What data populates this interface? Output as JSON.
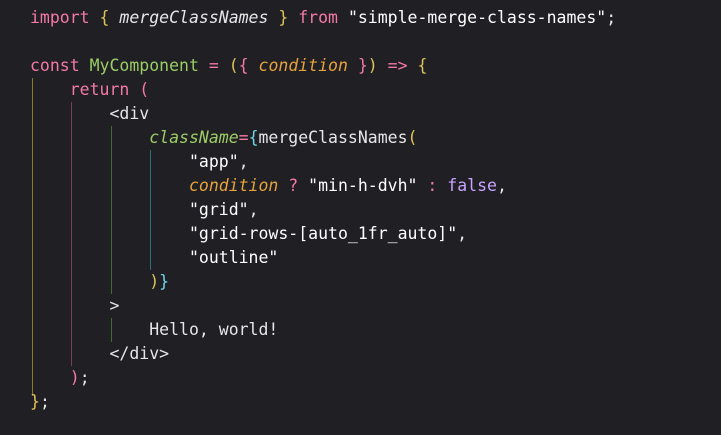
{
  "colors": {
    "background": "#1f1f24",
    "keyword": "#f47aa3",
    "punct": "#e0c357",
    "ident": "#e6e6e6",
    "param": "#e6a23c",
    "string": "#ffffff",
    "component": "#9ccc65",
    "attr": "#6fd6ea",
    "bool": "#c9a3ff",
    "tag": "#e6e6e6",
    "guide_yellow": "#8a7a2c",
    "guide_pink": "#7a3e56",
    "guide_green": "#3e6e2e",
    "guide_cyan": "#2e6e7a"
  },
  "lines": [
    [
      {
        "t": "import",
        "c": "keyword"
      },
      {
        "t": " ",
        "c": "ident"
      },
      {
        "t": "{",
        "c": "punct"
      },
      {
        "t": " ",
        "c": "ident"
      },
      {
        "t": "mergeClassNames",
        "c": "ident",
        "i": true
      },
      {
        "t": " ",
        "c": "ident"
      },
      {
        "t": "}",
        "c": "punct"
      },
      {
        "t": " ",
        "c": "ident"
      },
      {
        "t": "from",
        "c": "keyword"
      },
      {
        "t": " ",
        "c": "ident"
      },
      {
        "t": "\"simple-merge-class-names\"",
        "c": "string"
      },
      {
        "t": ";",
        "c": "ident"
      }
    ],
    [],
    [
      {
        "t": "const",
        "c": "keyword"
      },
      {
        "t": " ",
        "c": "ident"
      },
      {
        "t": "MyComponent",
        "c": "component"
      },
      {
        "t": " ",
        "c": "ident"
      },
      {
        "t": "=",
        "c": "keyword"
      },
      {
        "t": " ",
        "c": "ident"
      },
      {
        "t": "(",
        "c": "punct"
      },
      {
        "t": "{",
        "c": "keyword"
      },
      {
        "t": " ",
        "c": "ident"
      },
      {
        "t": "condition",
        "c": "param",
        "i": true
      },
      {
        "t": " ",
        "c": "ident"
      },
      {
        "t": "}",
        "c": "keyword"
      },
      {
        "t": ")",
        "c": "punct"
      },
      {
        "t": " ",
        "c": "ident"
      },
      {
        "t": "=>",
        "c": "keyword"
      },
      {
        "t": " ",
        "c": "ident"
      },
      {
        "t": "{",
        "c": "punct"
      }
    ],
    [
      {
        "t": "    ",
        "c": "ident"
      },
      {
        "t": "return",
        "c": "keyword"
      },
      {
        "t": " ",
        "c": "ident"
      },
      {
        "t": "(",
        "c": "keyword"
      }
    ],
    [
      {
        "t": "        ",
        "c": "ident"
      },
      {
        "t": "<div",
        "c": "tag"
      }
    ],
    [
      {
        "t": "            ",
        "c": "ident"
      },
      {
        "t": "className",
        "c": "component",
        "i": true
      },
      {
        "t": "=",
        "c": "keyword"
      },
      {
        "t": "{",
        "c": "attr"
      },
      {
        "t": "mergeClassNames",
        "c": "ident"
      },
      {
        "t": "(",
        "c": "punct"
      }
    ],
    [
      {
        "t": "                ",
        "c": "ident"
      },
      {
        "t": "\"app\"",
        "c": "string"
      },
      {
        "t": ",",
        "c": "ident"
      }
    ],
    [
      {
        "t": "                ",
        "c": "ident"
      },
      {
        "t": "condition",
        "c": "param",
        "i": true
      },
      {
        "t": " ",
        "c": "ident"
      },
      {
        "t": "?",
        "c": "keyword"
      },
      {
        "t": " ",
        "c": "ident"
      },
      {
        "t": "\"min-h-dvh\"",
        "c": "string"
      },
      {
        "t": " ",
        "c": "ident"
      },
      {
        "t": ":",
        "c": "keyword"
      },
      {
        "t": " ",
        "c": "ident"
      },
      {
        "t": "false",
        "c": "bool"
      },
      {
        "t": ",",
        "c": "ident"
      }
    ],
    [
      {
        "t": "                ",
        "c": "ident"
      },
      {
        "t": "\"grid\"",
        "c": "string"
      },
      {
        "t": ",",
        "c": "ident"
      }
    ],
    [
      {
        "t": "                ",
        "c": "ident"
      },
      {
        "t": "\"grid-rows-[auto_1fr_auto]\"",
        "c": "string"
      },
      {
        "t": ",",
        "c": "ident"
      }
    ],
    [
      {
        "t": "                ",
        "c": "ident"
      },
      {
        "t": "\"outline\"",
        "c": "string"
      }
    ],
    [
      {
        "t": "            ",
        "c": "ident"
      },
      {
        "t": ")",
        "c": "punct"
      },
      {
        "t": "}",
        "c": "attr"
      }
    ],
    [
      {
        "t": "        ",
        "c": "ident"
      },
      {
        "t": ">",
        "c": "tag"
      }
    ],
    [
      {
        "t": "            ",
        "c": "ident"
      },
      {
        "t": "Hello, world!",
        "c": "ident"
      }
    ],
    [
      {
        "t": "        ",
        "c": "ident"
      },
      {
        "t": "</div>",
        "c": "tag"
      }
    ],
    [
      {
        "t": "    ",
        "c": "ident"
      },
      {
        "t": ")",
        "c": "keyword"
      },
      {
        "t": ";",
        "c": "ident"
      }
    ],
    [
      {
        "t": "}",
        "c": "punct"
      },
      {
        "t": ";",
        "c": "ident"
      }
    ]
  ]
}
